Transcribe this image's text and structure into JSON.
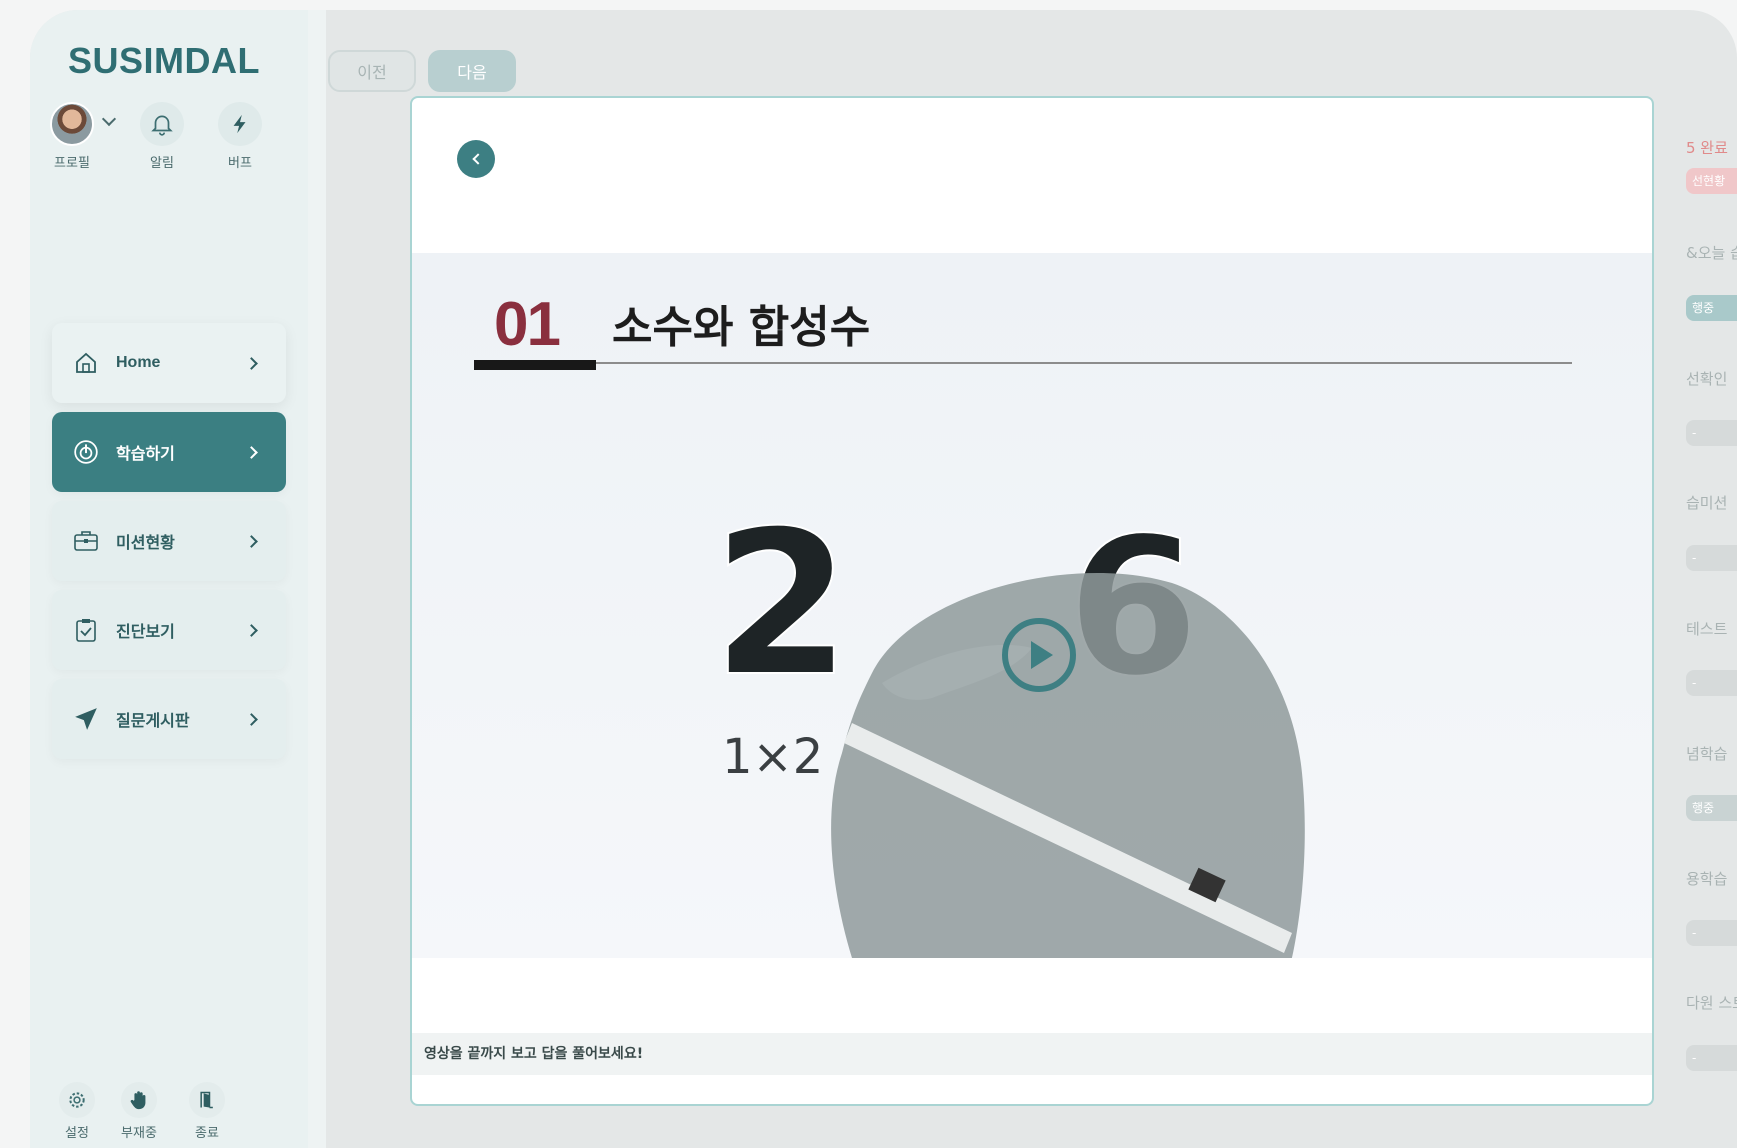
{
  "app": {
    "brand": "SUSIMDAL"
  },
  "header_icons": {
    "profile": "프로필",
    "alarm": "알림",
    "buff": "버프"
  },
  "nav": {
    "items": [
      {
        "label": "Home",
        "icon": "home-icon"
      },
      {
        "label": "학습하기",
        "icon": "study-icon",
        "active": true
      },
      {
        "label": "미션현황",
        "icon": "briefcase-icon"
      },
      {
        "label": "진단보기",
        "icon": "clipboard-check-icon"
      },
      {
        "label": "질문게시판",
        "icon": "send-icon"
      }
    ]
  },
  "bottom": {
    "settings": "설정",
    "away": "부재중",
    "exit": "종료"
  },
  "toolbar": {
    "prev": "이전",
    "next": "다음"
  },
  "background_list": {
    "items": [
      "5 완료",
      "선현황",
      "&오늘 습",
      "행중",
      "선확인",
      "-",
      "습미션",
      "-",
      "테스트",
      "-",
      "념학습",
      "행중",
      "용학습",
      "-",
      "다원 스트",
      "-"
    ]
  },
  "video": {
    "lesson_number": "01",
    "lesson_title": "소수와 합성수",
    "handwriting": [
      "2",
      "6",
      "1×2"
    ]
  },
  "instruction": "영상을 끝까지 보고 답을 풀어보세요!",
  "colors": {
    "accent": "#3b7f82",
    "brand": "#2f6e73",
    "lesson_number": "#8a2f3e"
  }
}
